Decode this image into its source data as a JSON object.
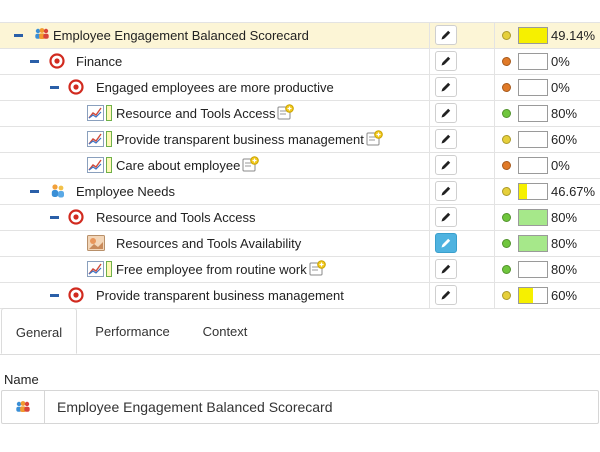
{
  "rows": [
    {
      "label": "Employee Engagement Balanced Scorecard",
      "level": 0,
      "icon": "team-icon",
      "collapse": true,
      "selected": true,
      "status": "#e6cf3a",
      "fill": 1.0,
      "fillColor": "#f6f000",
      "pct": "49.14%"
    },
    {
      "label": "Finance",
      "level": 1,
      "icon": "objective-target-icon",
      "collapse": true,
      "status": "#e07a28",
      "fill": 0,
      "fillColor": "#f6f000",
      "pct": "0%"
    },
    {
      "label": "Engaged employees are more productive",
      "level": 2,
      "icon": "objective-target-icon",
      "collapse": true,
      "status": "#e07a28",
      "fill": 0,
      "fillColor": "#f6f000",
      "pct": "0%"
    },
    {
      "label": "Resource and Tools Access",
      "level": 3,
      "icon": "kpi-chart-icon",
      "status": "#6fc63c",
      "fill": 0,
      "fillColor": "#a6e88a",
      "pct": "80%"
    },
    {
      "label": "Provide transparent business management",
      "level": 3,
      "icon": "kpi-chart-icon",
      "status": "#e6cf3a",
      "fill": 0,
      "fillColor": "#f6f000",
      "pct": "60%"
    },
    {
      "label": "Care about employee",
      "level": 3,
      "icon": "kpi-chart-icon",
      "status": "#e07a28",
      "fill": 0,
      "fillColor": "#f6f000",
      "pct": "0%"
    },
    {
      "label": "Employee Needs",
      "level": 1,
      "icon": "people-icon",
      "collapse": true,
      "status": "#e6cf3a",
      "fill": 0.3,
      "fillColor": "#f6f000",
      "pct": "46.67%"
    },
    {
      "label": "Resource and Tools Access",
      "level": 2,
      "icon": "objective-target-icon",
      "collapse": true,
      "status": "#6fc63c",
      "fill": 1.0,
      "fillColor": "#a6e88a",
      "pct": "80%"
    },
    {
      "label": "Resources and Tools Availability",
      "level": 3,
      "icon": "image-kpi-icon",
      "activeEdit": true,
      "status": "#6fc63c",
      "fill": 1.0,
      "fillColor": "#a6e88a",
      "pct": "80%"
    },
    {
      "label": "Free employee from routine work",
      "level": 3,
      "icon": "kpi-chart-icon",
      "status": "#6fc63c",
      "fill": 0,
      "fillColor": "#a6e88a",
      "pct": "80%"
    },
    {
      "label": "Provide transparent business management",
      "level": 2,
      "icon": "objective-target-icon",
      "collapse": true,
      "status": "#e6cf3a",
      "fill": 0.5,
      "fillColor": "#f6f000",
      "pct": "60%"
    }
  ],
  "tabs": [
    {
      "label": "General",
      "active": true
    },
    {
      "label": "Performance",
      "active": false
    },
    {
      "label": "Context",
      "active": false
    }
  ],
  "name_section": {
    "label": "Name",
    "value": "Employee Engagement Balanced Scorecard",
    "icon": "team-icon"
  },
  "colors": {
    "accent": "#2a5fa8",
    "selected_row": "#fcf5d6",
    "edit_active": "#4fb3e0"
  }
}
